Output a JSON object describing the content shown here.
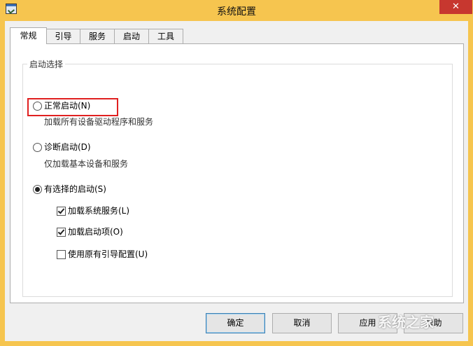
{
  "window": {
    "title": "系统配置",
    "close_glyph": "✕"
  },
  "tabs": [
    {
      "label": "常规",
      "active": true
    },
    {
      "label": "引导"
    },
    {
      "label": "服务"
    },
    {
      "label": "启动"
    },
    {
      "label": "工具"
    }
  ],
  "startup": {
    "group_title": "启动选择",
    "normal": {
      "label": "正常启动(N)",
      "desc": "加载所有设备驱动程序和服务",
      "selected": false
    },
    "diagnostic": {
      "label": "诊断启动(D)",
      "desc": "仅加载基本设备和服务",
      "selected": false
    },
    "selective": {
      "label": "有选择的启动(S)",
      "selected": true,
      "options": [
        {
          "label": "加载系统服务(L)",
          "checked": true
        },
        {
          "label": "加载启动项(O)",
          "checked": true
        },
        {
          "label": "使用原有引导配置(U)",
          "checked": false
        }
      ]
    }
  },
  "buttons": {
    "ok": "确定",
    "cancel": "取消",
    "apply": "应用",
    "help": "帮助"
  },
  "watermark": "系统之家"
}
